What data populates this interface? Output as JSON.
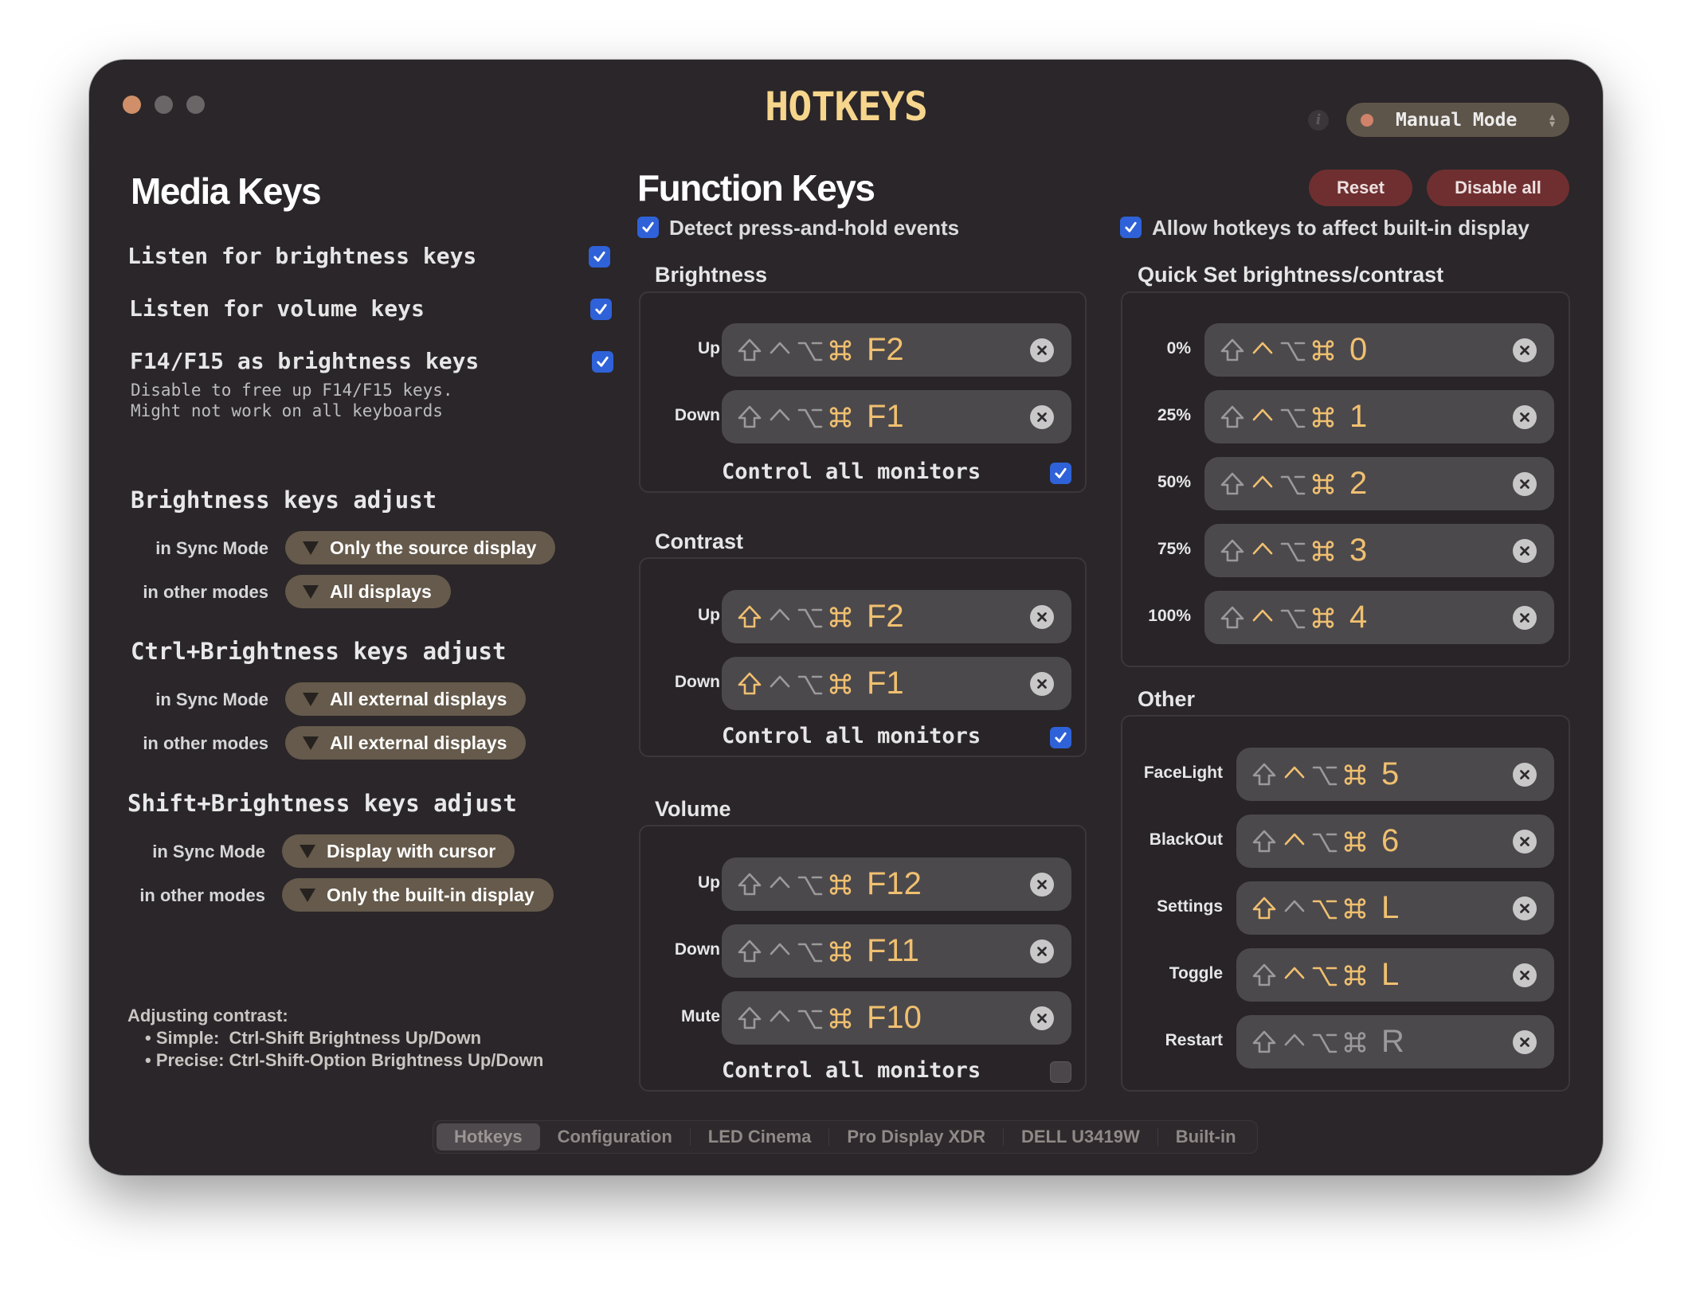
{
  "window": {
    "title": "HOTKEYS",
    "title_color": "#f6d58c",
    "traffic_lights": [
      {
        "name": "close",
        "color": "#d08f68"
      },
      {
        "name": "minimize",
        "color": "#6a6668"
      },
      {
        "name": "zoom",
        "color": "#6a6668"
      }
    ],
    "info_icon": "i",
    "mode_selector": {
      "label": "Manual Mode",
      "dot_color": "#d0826a",
      "arrows": "⌃⌄"
    }
  },
  "colors": {
    "accent_active": "#f0c070",
    "modifier_inactive": "#9a9a9a",
    "checkbox_blue": "#2f62d8",
    "danger_button": "#6f2f30",
    "dropdown_pill": "#655a4b"
  },
  "media_keys": {
    "heading": "Media Keys",
    "options": [
      {
        "label": "Listen for brightness keys",
        "checked": true
      },
      {
        "label": "Listen for volume keys",
        "checked": true
      },
      {
        "label": "F14/F15 as brightness keys",
        "checked": true,
        "description": [
          "Disable to free up F14/F15 keys.",
          "Might not work on all keyboards"
        ]
      }
    ],
    "adjust_sections": [
      {
        "heading": "Brightness keys adjust",
        "sync_label": "in Sync Mode",
        "sync_value": "Only the source display",
        "other_label": "in other modes",
        "other_value": "All displays"
      },
      {
        "heading": "Ctrl+Brightness keys adjust",
        "sync_label": "in Sync Mode",
        "sync_value": "All external displays",
        "other_label": "in other modes",
        "other_value": "All external displays"
      },
      {
        "heading": "Shift+Brightness keys adjust",
        "sync_label": "in Sync Mode",
        "sync_value": "Display with cursor",
        "other_label": "in other modes",
        "other_value": "Only the built-in display"
      }
    ],
    "contrast_note": {
      "title": "Adjusting contrast:",
      "lines": [
        "• Simple:  Ctrl-Shift Brightness Up/Down",
        "• Precise: Ctrl-Shift-Option Brightness Up/Down"
      ]
    }
  },
  "function_keys": {
    "heading": "Function Keys",
    "reset_label": "Reset",
    "disable_all_label": "Disable all",
    "detect_hold": {
      "label": "Detect press-and-hold events",
      "checked": true
    },
    "allow_builtin": {
      "label": "Allow hotkeys to affect built-in display",
      "checked": true
    },
    "control_all_label": "Control all monitors",
    "groups": {
      "brightness": {
        "label": "Brightness",
        "control_all": true,
        "rows": [
          {
            "label": "Up",
            "shift": false,
            "ctrl": false,
            "opt": false,
            "cmd": true,
            "key": "F2",
            "enabled": true
          },
          {
            "label": "Down",
            "shift": false,
            "ctrl": false,
            "opt": false,
            "cmd": true,
            "key": "F1",
            "enabled": true
          }
        ]
      },
      "contrast": {
        "label": "Contrast",
        "control_all": true,
        "rows": [
          {
            "label": "Up",
            "shift": true,
            "ctrl": false,
            "opt": false,
            "cmd": true,
            "key": "F2",
            "enabled": true
          },
          {
            "label": "Down",
            "shift": true,
            "ctrl": false,
            "opt": false,
            "cmd": true,
            "key": "F1",
            "enabled": true
          }
        ]
      },
      "volume": {
        "label": "Volume",
        "control_all": false,
        "rows": [
          {
            "label": "Up",
            "shift": false,
            "ctrl": false,
            "opt": false,
            "cmd": true,
            "key": "F12",
            "enabled": true
          },
          {
            "label": "Down",
            "shift": false,
            "ctrl": false,
            "opt": false,
            "cmd": true,
            "key": "F11",
            "enabled": true
          },
          {
            "label": "Mute",
            "shift": false,
            "ctrl": false,
            "opt": false,
            "cmd": true,
            "key": "F10",
            "enabled": true
          }
        ]
      },
      "quick_set": {
        "label": "Quick Set brightness/contrast",
        "rows": [
          {
            "label": "0%",
            "shift": false,
            "ctrl": true,
            "opt": false,
            "cmd": true,
            "key": "0",
            "enabled": true
          },
          {
            "label": "25%",
            "shift": false,
            "ctrl": true,
            "opt": false,
            "cmd": true,
            "key": "1",
            "enabled": true
          },
          {
            "label": "50%",
            "shift": false,
            "ctrl": true,
            "opt": false,
            "cmd": true,
            "key": "2",
            "enabled": true
          },
          {
            "label": "75%",
            "shift": false,
            "ctrl": true,
            "opt": false,
            "cmd": true,
            "key": "3",
            "enabled": true
          },
          {
            "label": "100%",
            "shift": false,
            "ctrl": true,
            "opt": false,
            "cmd": true,
            "key": "4",
            "enabled": true
          }
        ]
      },
      "other": {
        "label": "Other",
        "rows": [
          {
            "label": "FaceLight",
            "shift": false,
            "ctrl": true,
            "opt": false,
            "cmd": true,
            "key": "5",
            "enabled": true
          },
          {
            "label": "BlackOut",
            "shift": false,
            "ctrl": true,
            "opt": false,
            "cmd": true,
            "key": "6",
            "enabled": true
          },
          {
            "label": "Settings",
            "shift": true,
            "ctrl": false,
            "opt": true,
            "cmd": true,
            "key": "L",
            "enabled": true
          },
          {
            "label": "Toggle",
            "shift": false,
            "ctrl": true,
            "opt": true,
            "cmd": true,
            "key": "L",
            "enabled": true
          },
          {
            "label": "Restart",
            "shift": false,
            "ctrl": false,
            "opt": false,
            "cmd": false,
            "key": "R",
            "enabled": false
          }
        ]
      }
    }
  },
  "tabs": [
    {
      "label": "Hotkeys",
      "active": true
    },
    {
      "label": "Configuration",
      "active": false
    },
    {
      "label": "LED Cinema",
      "active": false
    },
    {
      "label": "Pro Display XDR",
      "active": false
    },
    {
      "label": "DELL U3419W",
      "active": false
    },
    {
      "label": "Built-in",
      "active": false
    }
  ]
}
